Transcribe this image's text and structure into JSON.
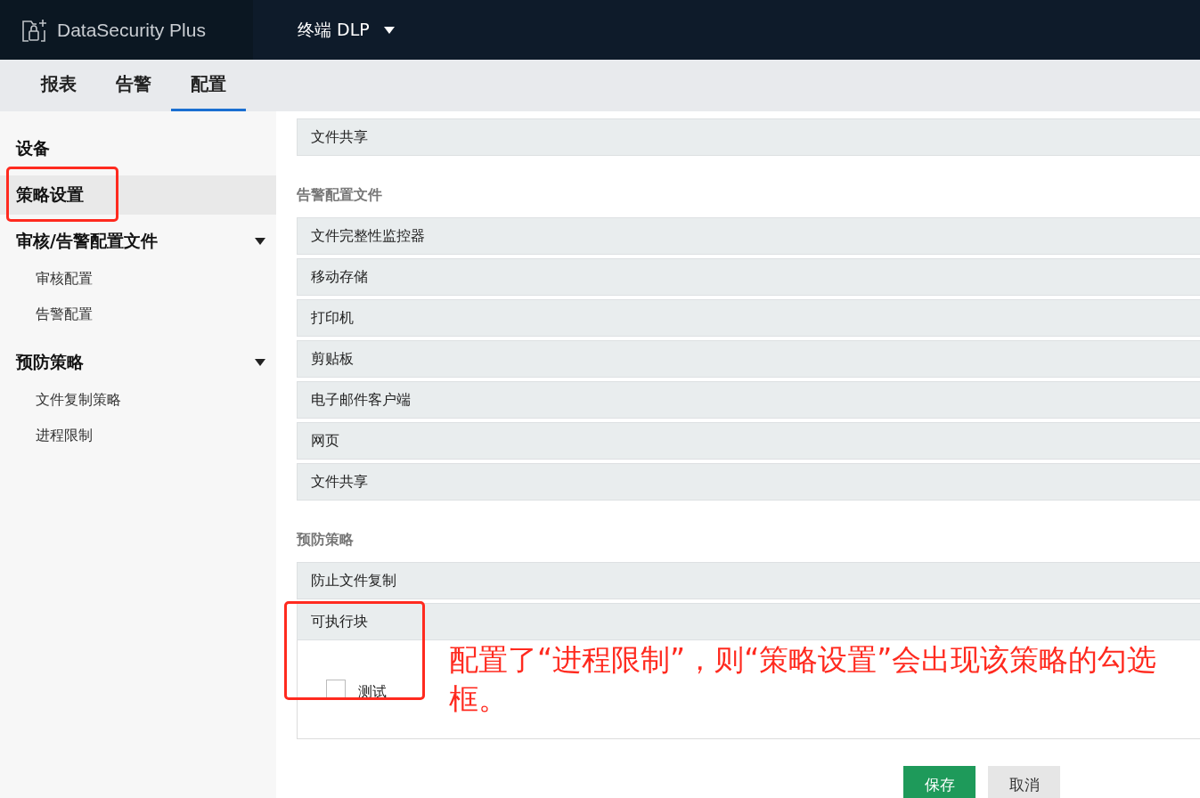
{
  "header": {
    "product": "DataSecurity Plus",
    "module": "终端 DLP"
  },
  "tabs": [
    {
      "label": "报表",
      "selected": false
    },
    {
      "label": "告警",
      "selected": false
    },
    {
      "label": "配置",
      "selected": true
    }
  ],
  "sidebar": {
    "items": [
      {
        "label": "设备",
        "selected": false
      },
      {
        "label": "策略设置",
        "selected": true,
        "highlighted": true
      },
      {
        "label": "审核/告警配置文件",
        "selected": false,
        "expanded": true,
        "children": [
          {
            "label": "审核配置"
          },
          {
            "label": "告警配置"
          }
        ]
      },
      {
        "label": "预防策略",
        "selected": false,
        "expanded": true,
        "children": [
          {
            "label": "文件复制策略"
          },
          {
            "label": "进程限制"
          }
        ]
      }
    ]
  },
  "sections": [
    {
      "items": [
        {
          "label": "文件共享"
        }
      ]
    },
    {
      "title": "告警配置文件",
      "items": [
        {
          "label": "文件完整性监控器"
        },
        {
          "label": "移动存储"
        },
        {
          "label": "打印机"
        },
        {
          "label": "剪贴板"
        },
        {
          "label": "电子邮件客户端"
        },
        {
          "label": "网页"
        },
        {
          "label": "文件共享"
        }
      ]
    },
    {
      "title": "预防策略",
      "items": [
        {
          "label": "防止文件复制"
        },
        {
          "label": "可执行块",
          "expanded": true,
          "highlighted": true,
          "options": [
            {
              "label": "测试",
              "checked": false
            }
          ]
        }
      ]
    }
  ],
  "annotation": "配置了“进程限制”，则“策略设置”会出现该策略的勾选框。",
  "buttons": [
    {
      "label": "保存",
      "kind": "primary"
    },
    {
      "label": "取消",
      "kind": "secondary"
    }
  ]
}
